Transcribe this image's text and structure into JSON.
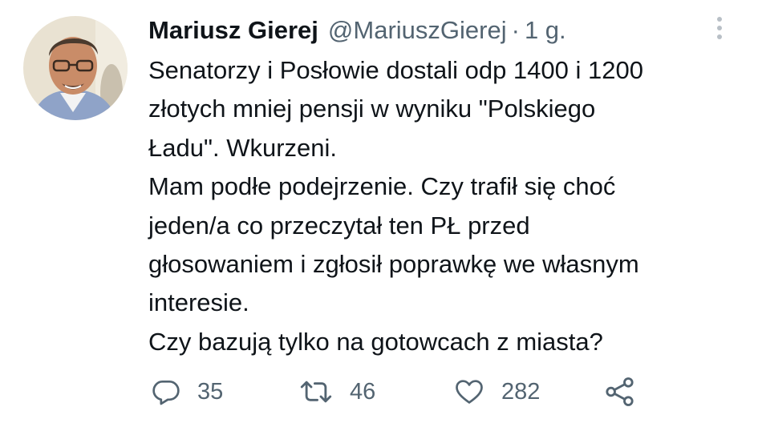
{
  "tweet": {
    "author": {
      "display_name": "Mariusz Gierej",
      "handle": "@MariuszGierej",
      "separator": "·",
      "time": "1 g."
    },
    "text_lines": [
      "Senatorzy i Posłowie dostali odp 1400 i 1200",
      "złotych mniej pensji w wyniku \"Polskiego",
      "Ładu\". Wkurzeni.",
      "Mam podłe podejrzenie. Czy trafił się choć",
      "jeden/a co przeczytał ten PŁ przed",
      "głosowaniem i zgłosił poprawkę we własnym",
      "interesie.",
      "Czy bazują tylko na gotowcach z miasta?"
    ],
    "actions": {
      "reply": {
        "icon": "reply-icon",
        "count": "35"
      },
      "retweet": {
        "icon": "retweet-icon",
        "count": "46"
      },
      "like": {
        "icon": "heart-icon",
        "count": "282"
      },
      "share": {
        "icon": "share-icon"
      }
    },
    "more_icon": "more-vertical-icon"
  },
  "colors": {
    "text_primary": "#0f1419",
    "text_secondary": "#536471",
    "background": "#ffffff"
  }
}
